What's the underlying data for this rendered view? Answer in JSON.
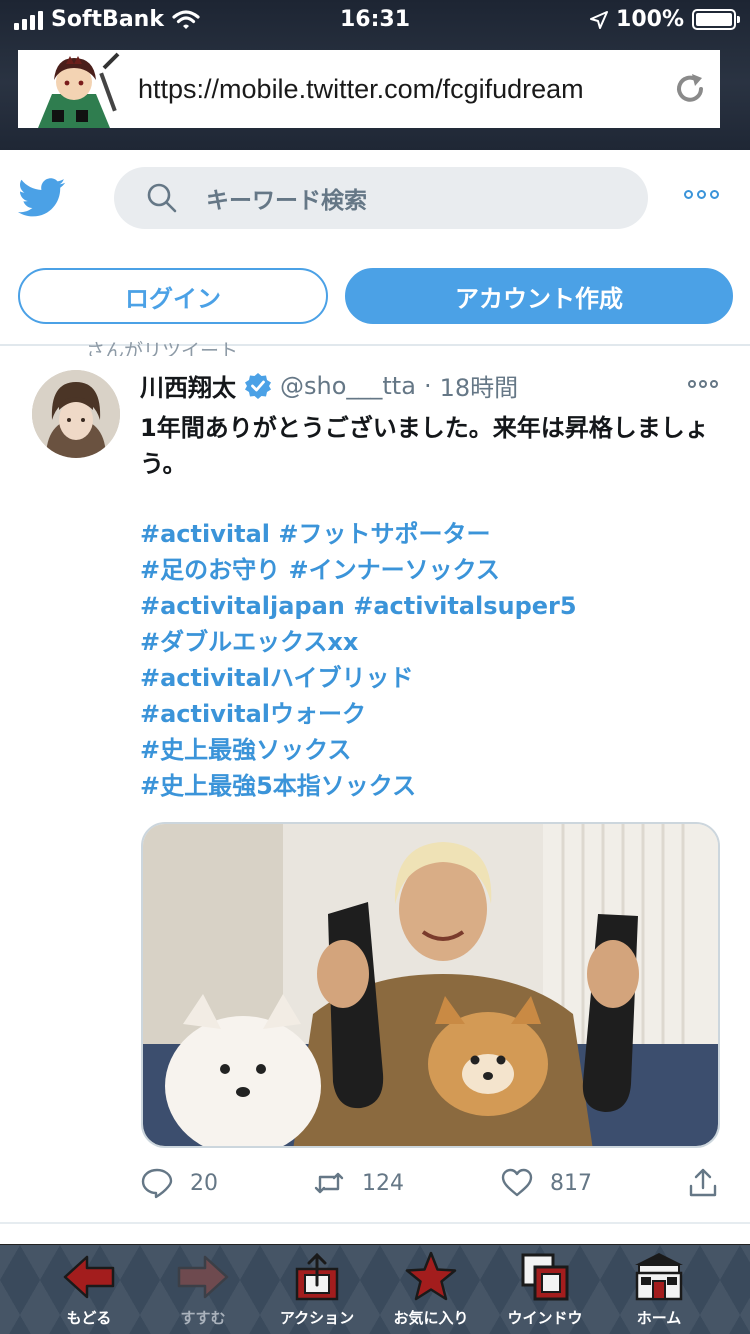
{
  "status_bar": {
    "carrier": "SoftBank",
    "time": "16:31",
    "battery": "100%"
  },
  "browser": {
    "url": "https://mobile.twitter.com/fcgifudream"
  },
  "twitter_header": {
    "search_placeholder": "キーワード検索",
    "login_label": "ログイン",
    "signup_label": "アカウント作成"
  },
  "tweet": {
    "context": "さんがリツイート",
    "author_name": "川西翔太",
    "handle": "@sho___tta",
    "separator": "·",
    "time": "18時間",
    "text": "1年間ありがとうございました。来年は昇格しましょう。",
    "hashtag_lines": [
      "#activital #フットサポーター",
      "#足のお守り #インナーソックス",
      "#activitaljapan #activitalsuper5",
      "#ダブルエックスxx",
      "#activitalハイブリッド",
      "#activitalウォーク",
      "#史上最強ソックス",
      "#史上最強5本指ソックス"
    ],
    "replies": "20",
    "retweets": "124",
    "likes": "817"
  },
  "toolbar": {
    "back": "もどる",
    "forward": "すすむ",
    "action": "アクション",
    "favorites": "お気に入り",
    "windows": "ウインドウ",
    "home": "ホーム"
  },
  "colors": {
    "twitter_blue": "#4ba1e6",
    "link_blue": "#3b94d9",
    "muted": "#657786"
  }
}
